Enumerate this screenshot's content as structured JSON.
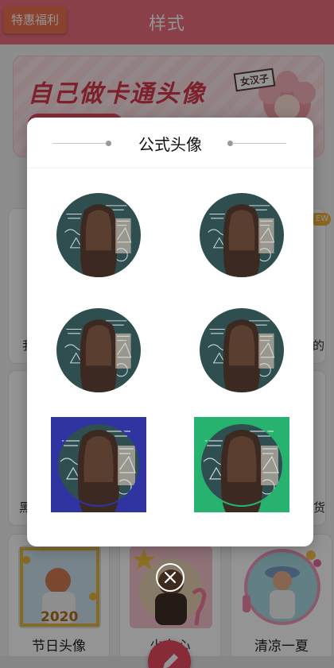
{
  "header": {
    "title": "样式",
    "promo_label": "特惠福利"
  },
  "banner": {
    "headline": "自己做卡通头像",
    "tag": "女汉子"
  },
  "background_cards": {
    "new_badge": "EW",
    "side_labels": [
      "我",
      "的",
      "黑",
      "货"
    ],
    "bottom": [
      {
        "label": "节日头像",
        "year": "2020"
      },
      {
        "label": "少女心"
      },
      {
        "label": "清凉一夏"
      }
    ]
  },
  "modal": {
    "title": "公式头像",
    "items": [
      {
        "name": "formula-avatar-1",
        "shape": "circle",
        "background": "#2e4e50"
      },
      {
        "name": "formula-avatar-2",
        "shape": "circle",
        "background": "#2e4e50"
      },
      {
        "name": "formula-avatar-3",
        "shape": "circle",
        "background": "#2e4e50"
      },
      {
        "name": "formula-avatar-4",
        "shape": "circle",
        "background": "#2e4e50"
      },
      {
        "name": "formula-avatar-5",
        "shape": "square",
        "background": "#3034a0"
      },
      {
        "name": "formula-avatar-6",
        "shape": "square",
        "background": "#27b36f"
      }
    ]
  },
  "colors": {
    "accent": "#ee6f7f",
    "promo": "#ee7350",
    "chalkboard": "#2e4e50"
  },
  "icons": {
    "close": "close-icon",
    "edit": "pencil-icon"
  }
}
